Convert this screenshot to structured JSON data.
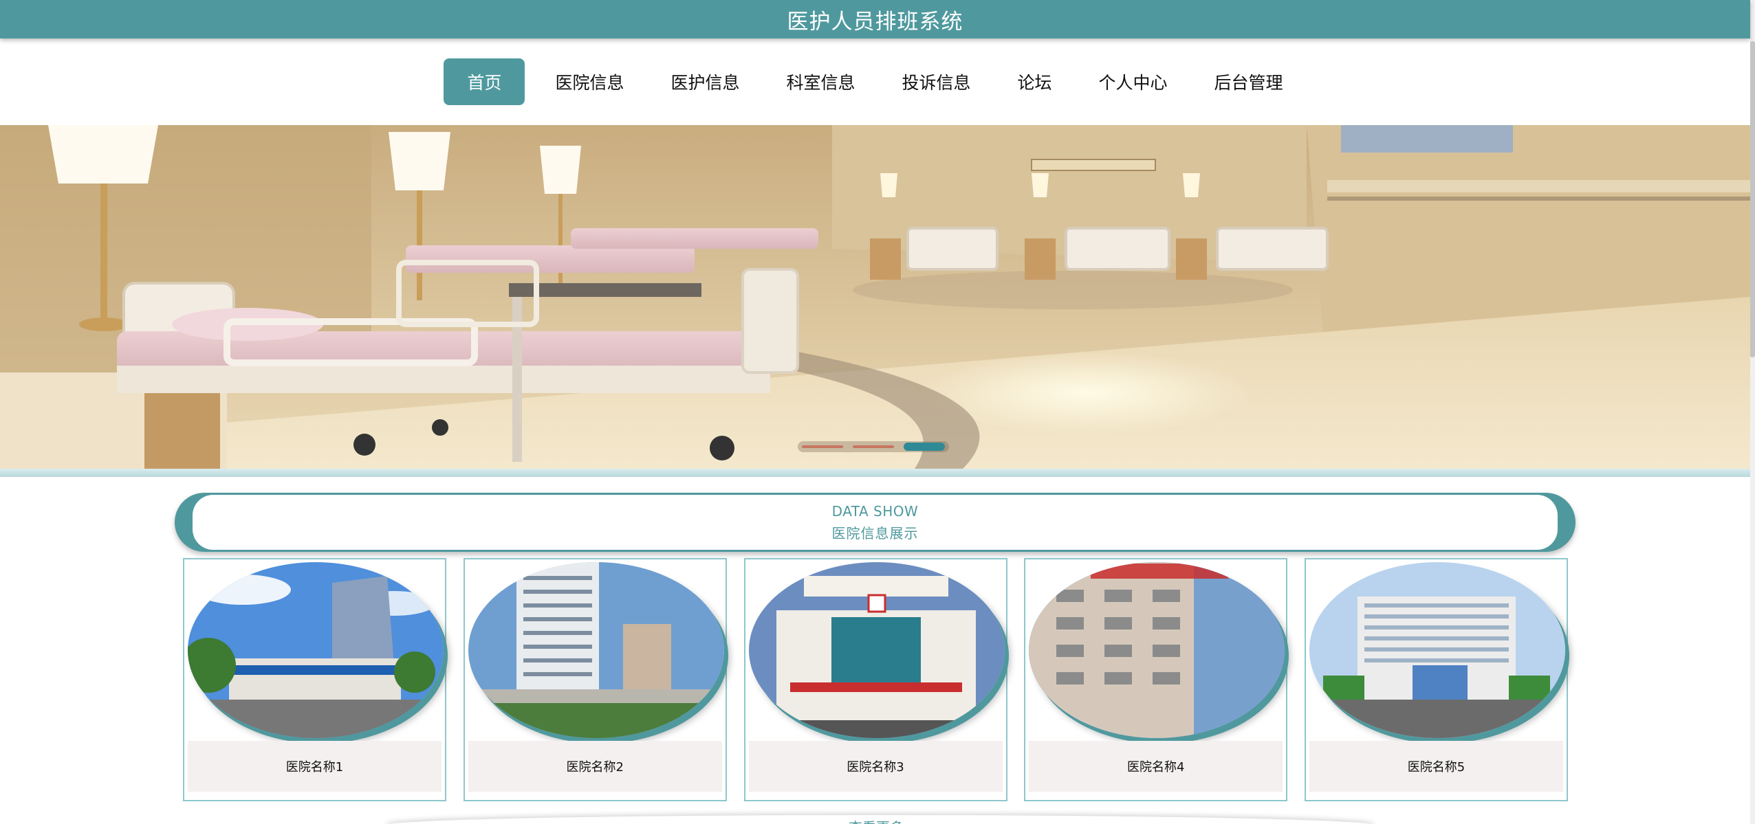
{
  "app": {
    "title": "医护人员排班系统"
  },
  "nav": {
    "items": [
      {
        "label": "首页",
        "active": true
      },
      {
        "label": "医院信息"
      },
      {
        "label": "医护信息"
      },
      {
        "label": "科室信息"
      },
      {
        "label": "投诉信息"
      },
      {
        "label": "论坛"
      },
      {
        "label": "个人中心"
      },
      {
        "label": "后台管理"
      }
    ]
  },
  "carousel": {
    "slide_count": 3,
    "active_index": 2
  },
  "section": {
    "title_en": "DATA SHOW",
    "title_cn": "医院信息展示"
  },
  "hospitals": [
    {
      "name": "医院名称1"
    },
    {
      "name": "医院名称2"
    },
    {
      "name": "医院名称3"
    },
    {
      "name": "医院名称4"
    },
    {
      "name": "医院名称5"
    }
  ],
  "more": {
    "label": "查看更多»"
  },
  "colors": {
    "accent": "#4f999e",
    "caption_bg": "#f3f0ef",
    "card_border": "#8ec7cc"
  }
}
